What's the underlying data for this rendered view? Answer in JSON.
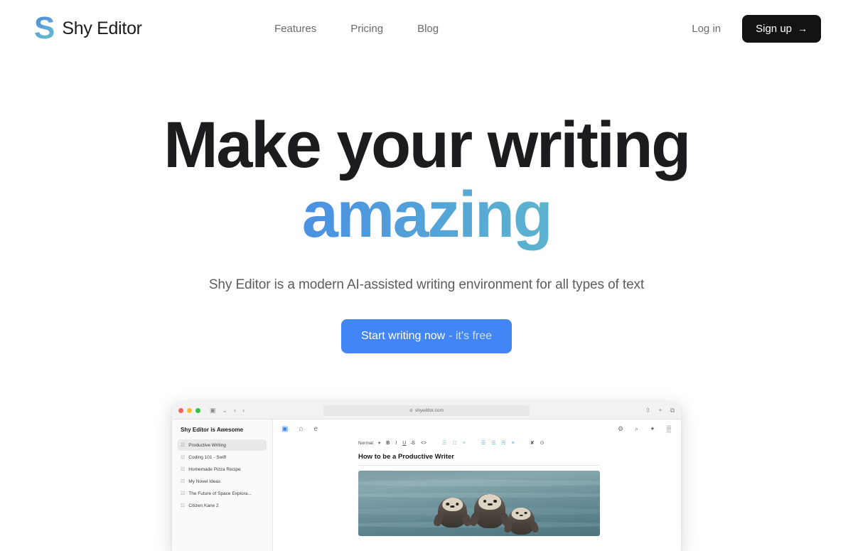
{
  "header": {
    "logo_letter": "S",
    "brand_name": "Shy Editor",
    "nav": [
      {
        "label": "Features"
      },
      {
        "label": "Pricing"
      },
      {
        "label": "Blog"
      }
    ],
    "login_label": "Log in",
    "signup_label": "Sign up",
    "signup_arrow": "→"
  },
  "hero": {
    "headline_line1": "Make your writing",
    "headline_line2": "amazing",
    "subtitle": "Shy Editor is a modern AI-assisted writing environment for all types of text",
    "cta_main": "Start writing now",
    "cta_sub": "- it's free"
  },
  "app_preview": {
    "browser": {
      "sidebar_toggle_icon": "▣",
      "chevron_icon": "⌄",
      "back_icon": "‹",
      "forward_icon": "›",
      "url": "shyeditor.com",
      "url_lock_icon": "⊕",
      "reader_icon": "⧉",
      "reload_icon": "↻",
      "share_icon": "⇧",
      "newtab_icon": "+",
      "tabs_icon": "⧉"
    },
    "sidebar": {
      "title": "Shy Editor is Awesome",
      "file_icon": "☷",
      "items": [
        {
          "label": "Productive Writing",
          "active": true
        },
        {
          "label": "Coding 101 - Swift",
          "active": false
        },
        {
          "label": "Homemade Pizza Recipe",
          "active": false
        },
        {
          "label": "My Novel Ideas",
          "active": false
        },
        {
          "label": "The Future of Space Explora...",
          "active": false
        },
        {
          "label": "Citizen Kane 2",
          "active": false
        }
      ]
    },
    "editor": {
      "panel_toggle_icon": "▣",
      "home_icon": "⌂",
      "new_doc_icon": "὜e",
      "settings_icon": "⚙",
      "search_icon": "⌕",
      "ai_icon": "✦",
      "grid_icon": "▒",
      "style_select": "Normal",
      "style_caret": "▾",
      "bold": "B",
      "italic": "I",
      "underline": "U",
      "strikethrough": "̶S",
      "code": "<>",
      "list_bullet": "☰",
      "list_number": "☷",
      "list_check": "≡",
      "align_left": "☰",
      "align_center": "☲",
      "align_right": "☴",
      "align_justify": "≡",
      "clear_format": "✘",
      "more": "⊙",
      "doc_title": "How to be a Productive Writer"
    }
  },
  "colors": {
    "accent_blue": "#4285f4",
    "gradient_start": "#3f7ff0",
    "gradient_end": "#66c9b4",
    "dark": "#131316"
  }
}
